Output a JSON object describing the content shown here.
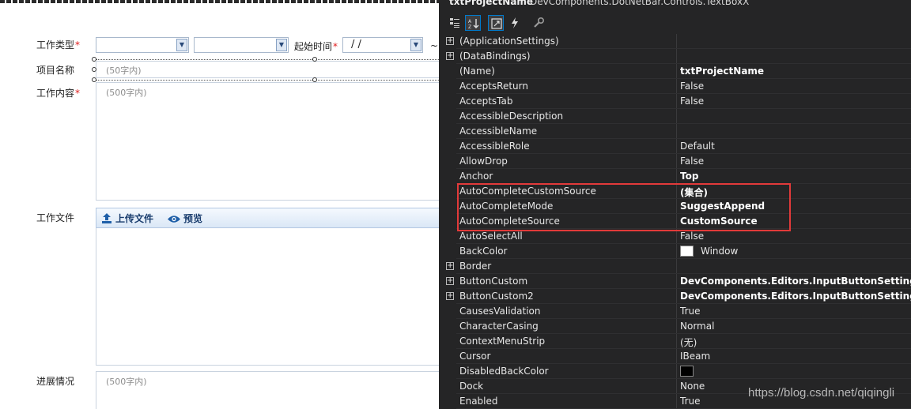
{
  "designer": {
    "work_type_label": "工作类型",
    "required_mark": "*",
    "start_time_label": "起始时间",
    "date_value": "/  /",
    "range_sep": "~",
    "project_name_label": "项目名称",
    "project_name_placeholder": "(50字内)",
    "work_content_label": "工作内容",
    "work_content_placeholder": "(500字内)",
    "work_file_label": "工作文件",
    "upload_label": "上传文件",
    "preview_label": "预览",
    "progress_label": "进展情况",
    "progress_placeholder": "(500字内)"
  },
  "properties": {
    "object_name": "txtProjectName",
    "object_type": "DevComponents.DotNetBar.Controls.TextBoxX",
    "toolbar": [
      "categorized-icon",
      "alphabetical-icon",
      "properties-icon",
      "events-icon",
      "property-pages-icon"
    ],
    "rows": [
      {
        "name": "(ApplicationSettings)",
        "value": "",
        "expandable": true,
        "bold": false
      },
      {
        "name": "(DataBindings)",
        "value": "",
        "expandable": true,
        "bold": false
      },
      {
        "name": "(Name)",
        "value": "txtProjectName",
        "expandable": false,
        "bold": true
      },
      {
        "name": "AcceptsReturn",
        "value": "False",
        "expandable": false,
        "bold": false
      },
      {
        "name": "AcceptsTab",
        "value": "False",
        "expandable": false,
        "bold": false
      },
      {
        "name": "AccessibleDescription",
        "value": "",
        "expandable": false,
        "bold": false
      },
      {
        "name": "AccessibleName",
        "value": "",
        "expandable": false,
        "bold": false
      },
      {
        "name": "AccessibleRole",
        "value": "Default",
        "expandable": false,
        "bold": false
      },
      {
        "name": "AllowDrop",
        "value": "False",
        "expandable": false,
        "bold": false
      },
      {
        "name": "Anchor",
        "value": "Top",
        "expandable": false,
        "bold": true
      },
      {
        "name": "AutoCompleteCustomSource",
        "value": "(集合)",
        "expandable": false,
        "bold": true
      },
      {
        "name": "AutoCompleteMode",
        "value": "SuggestAppend",
        "expandable": false,
        "bold": true
      },
      {
        "name": "AutoCompleteSource",
        "value": "CustomSource",
        "expandable": false,
        "bold": true
      },
      {
        "name": "AutoSelectAll",
        "value": "False",
        "expandable": false,
        "bold": false
      },
      {
        "name": "BackColor",
        "value": "Window",
        "expandable": false,
        "bold": false,
        "swatch": "#ffffff"
      },
      {
        "name": "Border",
        "value": "",
        "expandable": true,
        "bold": false
      },
      {
        "name": "ButtonCustom",
        "value": "DevComponents.Editors.InputButtonSettings",
        "expandable": true,
        "bold": true
      },
      {
        "name": "ButtonCustom2",
        "value": "DevComponents.Editors.InputButtonSettings",
        "expandable": true,
        "bold": true
      },
      {
        "name": "CausesValidation",
        "value": "True",
        "expandable": false,
        "bold": false
      },
      {
        "name": "CharacterCasing",
        "value": "Normal",
        "expandable": false,
        "bold": false
      },
      {
        "name": "ContextMenuStrip",
        "value": "(无)",
        "expandable": false,
        "bold": false
      },
      {
        "name": "Cursor",
        "value": "IBeam",
        "expandable": false,
        "bold": false
      },
      {
        "name": "DisabledBackColor",
        "value": "",
        "expandable": false,
        "bold": false,
        "swatch": "#000000"
      },
      {
        "name": "Dock",
        "value": "None",
        "expandable": false,
        "bold": false
      },
      {
        "name": "Enabled",
        "value": "True",
        "expandable": false,
        "bold": false
      }
    ]
  },
  "watermark": "https://blog.csdn.net/qiqingli",
  "colors": {
    "highlight": "#e23a3a",
    "panel_bg": "#252526",
    "accent": "#007acc"
  }
}
